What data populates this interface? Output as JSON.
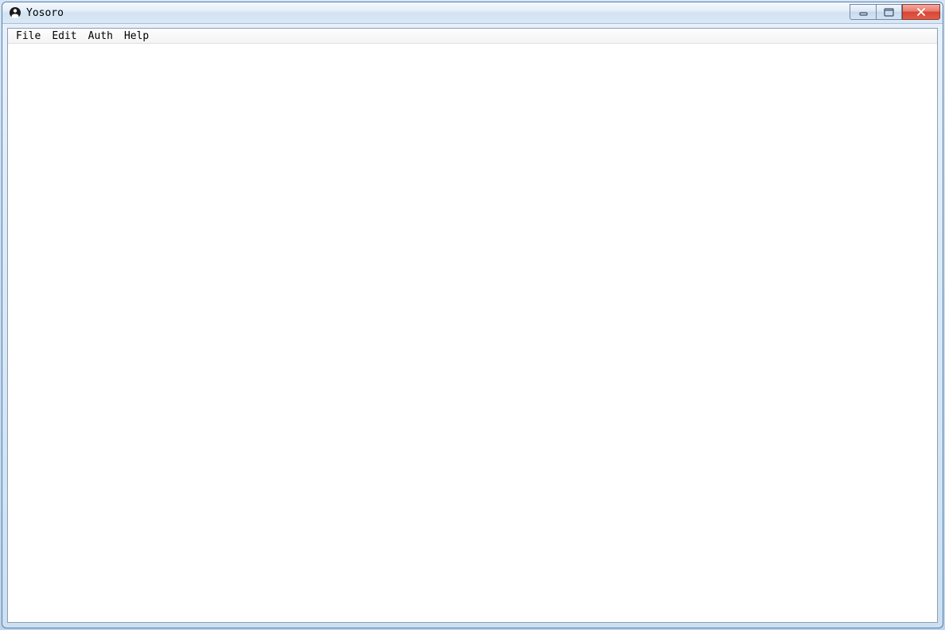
{
  "window": {
    "title": "Yosoro"
  },
  "menubar": {
    "items": [
      {
        "label": "File"
      },
      {
        "label": "Edit"
      },
      {
        "label": "Auth"
      },
      {
        "label": "Help"
      }
    ]
  }
}
